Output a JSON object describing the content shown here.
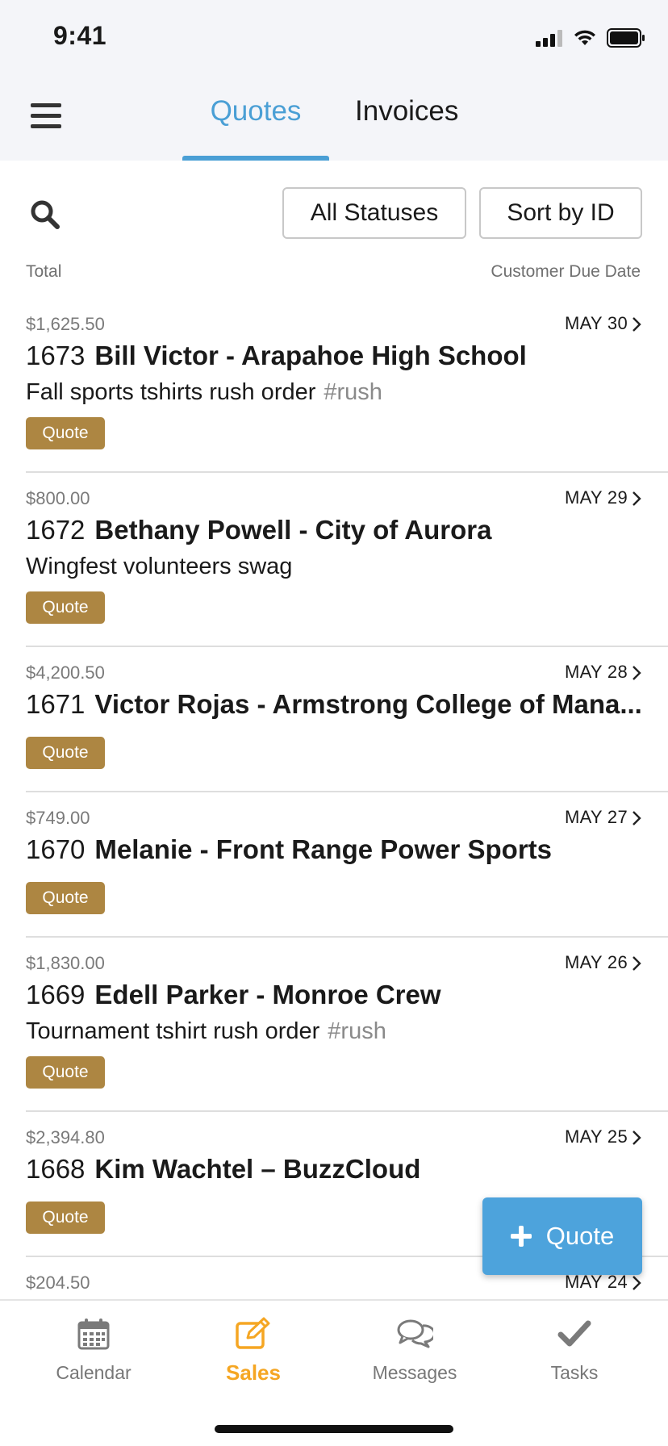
{
  "status_bar": {
    "time": "9:41"
  },
  "header": {
    "tabs": [
      {
        "label": "Quotes",
        "active": true
      },
      {
        "label": "Invoices",
        "active": false
      }
    ],
    "accent_color": "#4a9fd5"
  },
  "toolbar": {
    "status_filter": "All Statuses",
    "sort": "Sort by ID"
  },
  "columns": {
    "left": "Total",
    "right": "Customer Due Date"
  },
  "quotes": [
    {
      "amount": "$1,625.50",
      "due": "MAY 30",
      "id": "1673",
      "customer": "Bill Victor - Arapahoe High School",
      "description": "Fall sports tshirts rush order",
      "tag": "#rush",
      "status": "Quote"
    },
    {
      "amount": "$800.00",
      "due": "MAY 29",
      "id": "1672",
      "customer": "Bethany Powell - City of Aurora",
      "description": "Wingfest volunteers swag",
      "tag": "",
      "status": "Quote"
    },
    {
      "amount": "$4,200.50",
      "due": "MAY 28",
      "id": "1671",
      "customer": "Victor Rojas - Armstrong College of Mana...",
      "description": "",
      "tag": "",
      "status": "Quote"
    },
    {
      "amount": "$749.00",
      "due": "MAY 27",
      "id": "1670",
      "customer": "Melanie - Front Range Power Sports",
      "description": "",
      "tag": "",
      "status": "Quote"
    },
    {
      "amount": "$1,830.00",
      "due": "MAY 26",
      "id": "1669",
      "customer": "Edell Parker - Monroe Crew",
      "description": "Tournament tshirt rush order",
      "tag": "#rush",
      "status": "Quote"
    },
    {
      "amount": "$2,394.80",
      "due": "MAY 25",
      "id": "1668",
      "customer": "Kim Wachtel – BuzzCloud",
      "description": "",
      "tag": "",
      "status": "Quote"
    },
    {
      "amount": "$204.50",
      "due": "MAY 24",
      "id": "",
      "customer": "",
      "description": "",
      "tag": "",
      "status": ""
    }
  ],
  "badge_color": "#ad8642",
  "fab": {
    "label": "Quote",
    "icon": "plus-icon"
  },
  "bottom_nav": [
    {
      "label": "Calendar",
      "icon": "calendar-icon",
      "active": false
    },
    {
      "label": "Sales",
      "icon": "edit-icon",
      "active": true
    },
    {
      "label": "Messages",
      "icon": "chat-icon",
      "active": false
    },
    {
      "label": "Tasks",
      "icon": "check-icon",
      "active": false
    }
  ],
  "nav_active_color": "#f5a623"
}
